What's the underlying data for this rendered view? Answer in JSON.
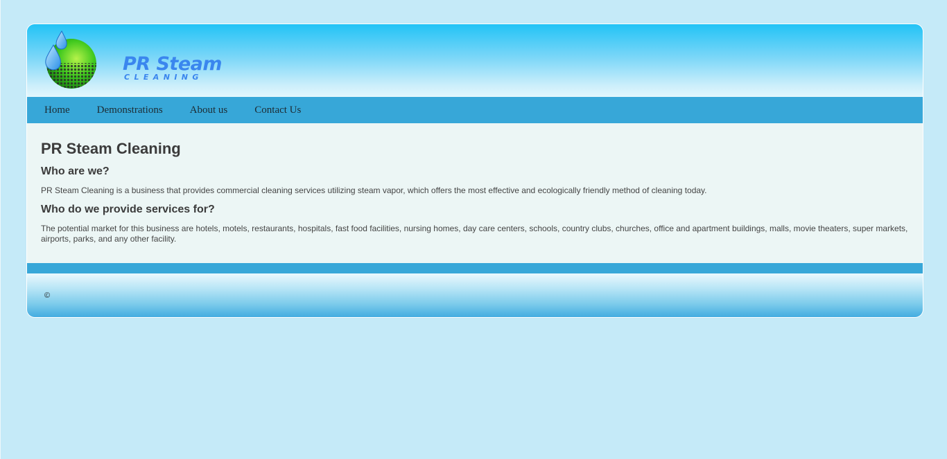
{
  "logo": {
    "word": "PR Steam",
    "sub": "CLEANING"
  },
  "nav": {
    "items": [
      {
        "label": "Home"
      },
      {
        "label": "Demonstrations"
      },
      {
        "label": "About us"
      },
      {
        "label": "Contact Us"
      }
    ]
  },
  "main": {
    "title": "PR Steam Cleaning",
    "section1_heading": "Who are we?",
    "section1_text": "PR Steam Cleaning is a business that provides commercial cleaning services utilizing steam vapor, which offers the most effective and ecologically friendly method of cleaning today.",
    "section2_heading": "Who do we provide services for?",
    "section2_text": "The potential market for this business are hotels, motels, restaurants, hospitals, fast food facilities, nursing homes, day care centers, schools, country clubs, churches, office and apartment buildings, malls, movie theaters, super markets, airports, parks, and any other facility."
  },
  "footer": {
    "copyright": "©"
  },
  "colors": {
    "page_bg": "#c5eaf8",
    "nav_bg": "#37a7d8",
    "content_bg": "#ecf6f5",
    "logo_blue": "#3a86ee"
  }
}
